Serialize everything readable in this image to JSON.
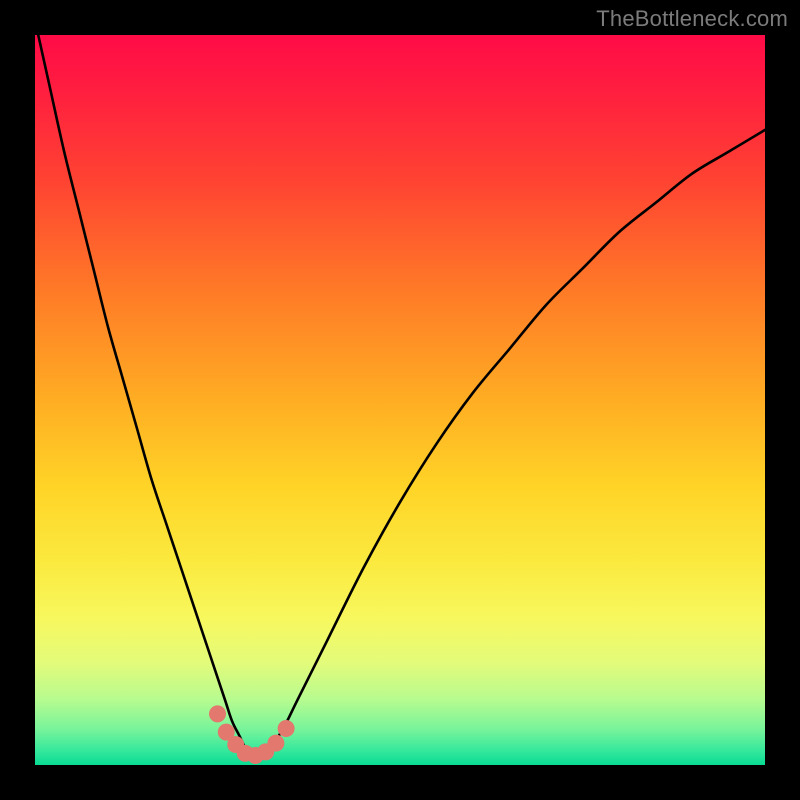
{
  "watermark": "TheBottleneck.com",
  "chart_data": {
    "type": "line",
    "title": "",
    "xlabel": "",
    "ylabel": "",
    "xlim": [
      0,
      100
    ],
    "ylim": [
      0,
      100
    ],
    "series": [
      {
        "name": "bottleneck-curve",
        "x": [
          0,
          2,
          4,
          6,
          8,
          10,
          12,
          14,
          16,
          18,
          20,
          22,
          24,
          26,
          27,
          28,
          29,
          30,
          31,
          32,
          34,
          36,
          40,
          45,
          50,
          55,
          60,
          65,
          70,
          75,
          80,
          85,
          90,
          95,
          100
        ],
        "values": [
          102,
          93,
          84,
          76,
          68,
          60,
          53,
          46,
          39,
          33,
          27,
          21,
          15,
          9,
          6,
          4,
          2,
          1,
          1,
          2,
          5,
          9,
          17,
          27,
          36,
          44,
          51,
          57,
          63,
          68,
          73,
          77,
          81,
          84,
          87
        ]
      }
    ],
    "markers": {
      "name": "highlight-points",
      "color": "#e2786e",
      "points": [
        {
          "x": 25.0,
          "y": 7.0
        },
        {
          "x": 26.2,
          "y": 4.5
        },
        {
          "x": 27.5,
          "y": 2.8
        },
        {
          "x": 28.8,
          "y": 1.6
        },
        {
          "x": 30.2,
          "y": 1.3
        },
        {
          "x": 31.6,
          "y": 1.8
        },
        {
          "x": 33.0,
          "y": 3.0
        },
        {
          "x": 34.4,
          "y": 5.0
        }
      ]
    }
  }
}
